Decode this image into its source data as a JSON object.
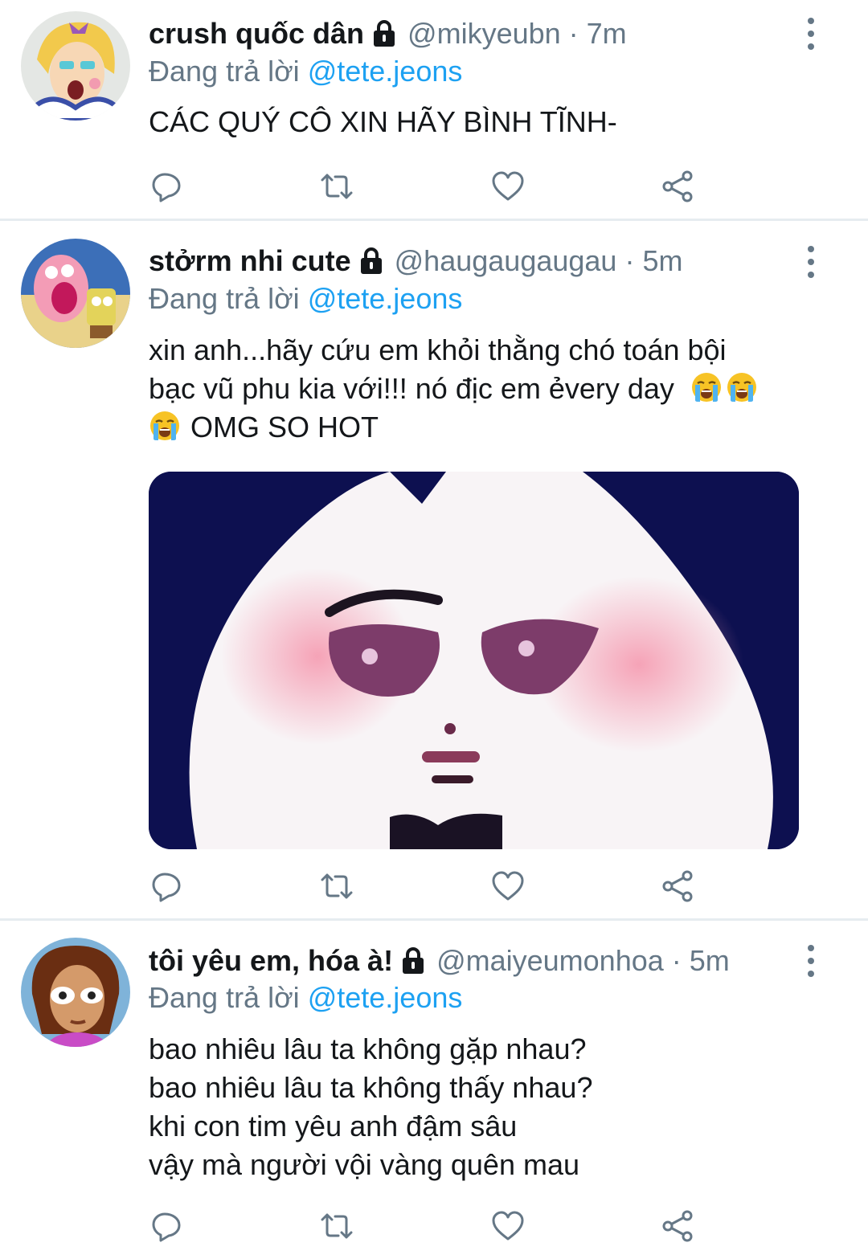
{
  "reply_prefix": "Đang trả lời",
  "colors": {
    "accent": "#1da1f2",
    "secondary": "#657786",
    "divider": "#e6ecf0"
  },
  "tweets": [
    {
      "name": "crush quốc dân",
      "handle": "@mikyeubn",
      "time": "7m",
      "reply_to": "@tete.jeons",
      "text_lines": [
        "CÁC QUÝ CÔ XIN HÃY BÌNH TĨNH-"
      ]
    },
    {
      "name": "stởrm nhi cute",
      "handle": "@haugaugaugau",
      "time": "5m",
      "reply_to": "@tete.jeons",
      "text_lines": [
        "xin anh...hãy cứu em khỏi thằng chó toán bội",
        "bạc vũ phu kia với!!! nó địc em ẻvery day",
        "OMG SO HOT"
      ],
      "emoji": "loudly-crying-face"
    },
    {
      "name": "tôi yêu em, hóa à!",
      "handle": "@maiyeumonhoa",
      "time": "5m",
      "reply_to": "@tete.jeons",
      "text_lines": [
        "bao nhiêu lâu ta không gặp nhau?",
        "bao nhiêu lâu ta không thấy nhau?",
        "khi con tim yêu anh đậm sâu",
        "vậy mà người vội vàng quên mau"
      ]
    }
  ],
  "actions": [
    "reply-icon",
    "retweet-icon",
    "like-icon",
    "share-icon"
  ]
}
